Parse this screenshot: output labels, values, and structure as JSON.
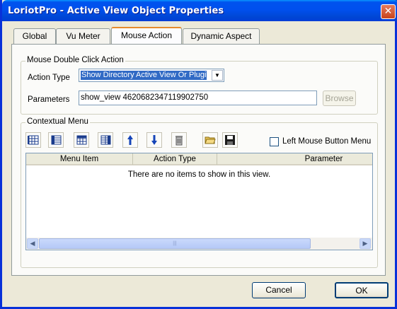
{
  "window": {
    "title": "LoriotPro - Active View Object Properties"
  },
  "tabs": [
    {
      "label": "Global",
      "active": false
    },
    {
      "label": "Vu Meter",
      "active": false
    },
    {
      "label": "Mouse Action",
      "active": true
    },
    {
      "label": "Dynamic Aspect",
      "active": false
    }
  ],
  "double_click": {
    "group_label": "Mouse Double Click Action",
    "action_type_label": "Action Type",
    "action_type_value": "Show Directory Active View Or Plugin",
    "parameters_label": "Parameters",
    "parameters_value": "show_view 4620682347119902750",
    "browse_label": "Browse"
  },
  "contextual_menu": {
    "group_label": "Contextual Menu",
    "left_mouse_label": "Left Mouse Button Menu",
    "left_mouse_checked": false,
    "columns": [
      "Menu Item",
      "Action Type",
      "Parameter"
    ],
    "empty_text": "There are no items to show in this view.",
    "toolbar_icons": [
      "add-row-icon",
      "insert-row-icon",
      "edit-row-icon",
      "delete-row-icon",
      "move-up-icon",
      "move-down-icon",
      "trash-icon",
      "open-folder-icon",
      "save-icon"
    ]
  },
  "footer": {
    "cancel_label": "Cancel",
    "ok_label": "OK"
  },
  "colors": {
    "title_bar": "#0053ee",
    "selection": "#316ac5",
    "tab_highlight": "#e68b2c",
    "window_bg": "#ece9d8"
  }
}
